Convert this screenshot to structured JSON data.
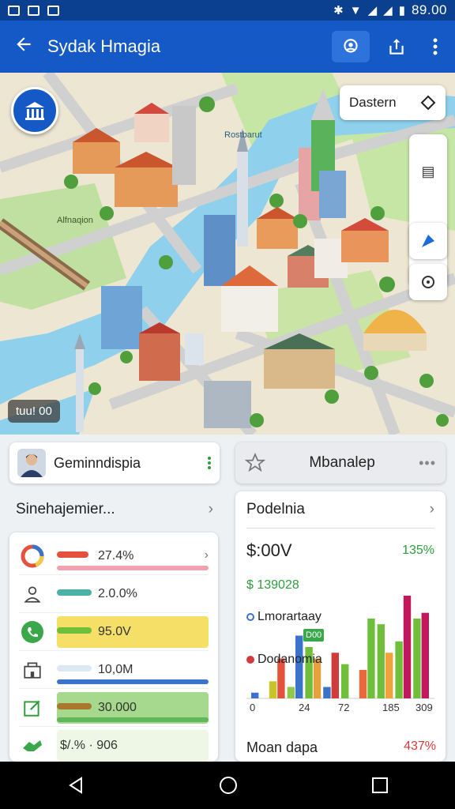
{
  "status": {
    "time": "89.00"
  },
  "app_bar": {
    "title": "Sydak Hmagia"
  },
  "map": {
    "scale_label": "tuu! 00",
    "destination_label": "Dastern",
    "place_label_1": "Rostbarut",
    "place_label_2": "Alfnaqion"
  },
  "profile": {
    "name": "Geminndispia"
  },
  "favorite": {
    "name": "Mbanalep"
  },
  "left_panel": {
    "title": "Sinehajemier...",
    "rows": [
      {
        "value": "27.4%",
        "color": "#e4523e",
        "under": "#f0a3ae"
      },
      {
        "value": "2.0.0%",
        "color": "#4bb1a8",
        "under": "#f2f2f2"
      },
      {
        "value": "95.0V",
        "color": "#6fbf3b",
        "under": "#f5df66"
      },
      {
        "value": "10,0M",
        "color": "#dde8f5",
        "under": "#3a73c9"
      },
      {
        "value": "30.000",
        "color": "#a9782c",
        "under": "#5fb85a"
      },
      {
        "value": "$/.%  · 906",
        "color": "",
        "under": ""
      }
    ]
  },
  "chart": {
    "title": "Podelnia",
    "big_value": "$:00V",
    "big_pct": "135%",
    "sub_value": "$ 139028",
    "legend_1": "Lmorartaay",
    "legend_2": "Dodanomia",
    "badge": "D00",
    "footer_label": "Moan dapa",
    "footer_pct": "437%"
  },
  "chart_data": {
    "type": "bar",
    "x_ticks": [
      "0",
      "24",
      "72",
      "185",
      "309"
    ],
    "series": [
      {
        "name": "Lmorartaay",
        "values": [
          1,
          3,
          2,
          9,
          2,
          6,
          5,
          13,
          10,
          14
        ]
      },
      {
        "name": "Dodanomia",
        "values": [
          0,
          7,
          11,
          7,
          8,
          0,
          14,
          8,
          18,
          15
        ]
      }
    ]
  },
  "colors": {
    "app_bar": "#1559c6",
    "status_bar": "#0b3f8f",
    "accent_green": "#2e9d3a",
    "accent_red": "#d13b3b"
  }
}
